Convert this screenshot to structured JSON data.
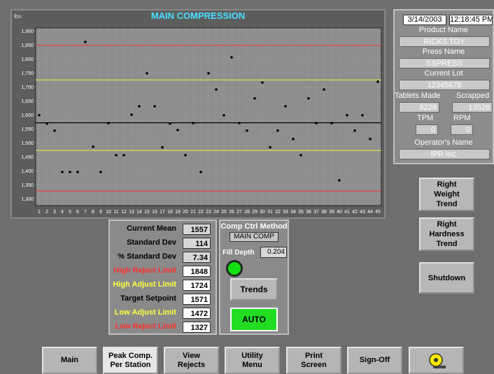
{
  "chart": {
    "title": "MAIN COMPRESSION",
    "unit": "lbs.",
    "y_ticks": [
      "1,900",
      "1,850",
      "1,800",
      "1,750",
      "1,700",
      "1,650",
      "1,600",
      "1,550",
      "1,500",
      "1,450",
      "1,400",
      "1,350",
      "1,300"
    ],
    "x_ticks": [
      "1",
      "2",
      "3",
      "4",
      "5",
      "6",
      "7",
      "8",
      "9",
      "10",
      "11",
      "12",
      "13",
      "14",
      "15",
      "16",
      "17",
      "18",
      "19",
      "20",
      "21",
      "22",
      "23",
      "24",
      "25",
      "26",
      "27",
      "28",
      "29",
      "30",
      "31",
      "32",
      "33",
      "34",
      "35",
      "36",
      "37",
      "38",
      "39",
      "40",
      "41",
      "42",
      "43",
      "44",
      "45"
    ]
  },
  "chart_data": {
    "type": "scatter",
    "title": "MAIN COMPRESSION",
    "ylabel": "lbs.",
    "ylim": [
      1275,
      1910
    ],
    "x": [
      1,
      2,
      3,
      4,
      5,
      6,
      7,
      8,
      9,
      10,
      11,
      12,
      13,
      14,
      15,
      16,
      17,
      18,
      19,
      20,
      21,
      22,
      23,
      24,
      25,
      26,
      27,
      28,
      29,
      30,
      31,
      32,
      33,
      34,
      35,
      36,
      37,
      38,
      39,
      40,
      41,
      42,
      43,
      44,
      45
    ],
    "values": [
      1598,
      1568,
      1543,
      1395,
      1395,
      1395,
      1860,
      1485,
      1395,
      1570,
      1455,
      1455,
      1600,
      1630,
      1748,
      1630,
      1483,
      1568,
      1545,
      1455,
      1570,
      1395,
      1748,
      1690,
      1598,
      1805,
      1570,
      1543,
      1658,
      1715,
      1483,
      1543,
      1630,
      1513,
      1455,
      1658,
      1570,
      1690,
      1570,
      1365,
      1598,
      1543,
      1598,
      1513,
      1718
    ],
    "reference_lines": [
      {
        "name": "High Reject Limit",
        "value": 1848,
        "color": "#e03b3b"
      },
      {
        "name": "High Adjust Limit",
        "value": 1724,
        "color": "#e0e04a"
      },
      {
        "name": "Target Setpoint",
        "value": 1571,
        "color": "#000000"
      },
      {
        "name": "Low Adjust Limit",
        "value": 1472,
        "color": "#e0e04a"
      },
      {
        "name": "Low Reject Limit",
        "value": 1327,
        "color": "#e03b3b"
      }
    ]
  },
  "stats": [
    {
      "label": "Current Mean",
      "value": "1557",
      "color": "#000000",
      "box": "readonly"
    },
    {
      "label": "Standard Dev",
      "value": "114",
      "color": "#000000",
      "box": "readonly"
    },
    {
      "label": "% Standard Dev",
      "value": "7.34",
      "color": "#000000",
      "box": "readonly"
    },
    {
      "label": "High Reject Limit",
      "value": "1848",
      "color": "#ff3030",
      "box": "white"
    },
    {
      "label": "High Adjust Limit",
      "value": "1724",
      "color": "#ffff40",
      "box": "white"
    },
    {
      "label": "Target Setpoint",
      "value": "1571",
      "color": "#000000",
      "box": "white"
    },
    {
      "label": "Low Adjust Limit",
      "value": "1472",
      "color": "#ffff40",
      "box": "white"
    },
    {
      "label": "Low Reject Limit",
      "value": "1327",
      "color": "#ff3030",
      "box": "white"
    }
  ],
  "comp": {
    "title": "Comp Ctrl Method",
    "method": "MAIN COMP",
    "fill_label": "Fill Depth",
    "fill_value": "0.204",
    "trends": "Trends",
    "auto": "AUTO"
  },
  "info": {
    "date": "3/14/2003",
    "time": "12:18:45 PM",
    "product_label": "Product Name",
    "product": "RICKS TOY",
    "press_label": "Press Name",
    "press": "SSPRESS",
    "lot_label": "Current Lot",
    "lot": "12345678",
    "tablets_label": "Tablets Made",
    "tablets": "8228",
    "scrapped_label": "Scrapped",
    "scrapped": "13528",
    "tpm_label": "TPM",
    "tpm": "0",
    "rpm_label": "RPM",
    "rpm": "0",
    "operator_label": "Operator's Name",
    "operator": "IPR Inc."
  },
  "side_buttons": {
    "weight": "Right\nWeight\nTrend",
    "hardness": "Right\nHardness\nTrend",
    "shutdown": "Shutdown"
  },
  "nav": [
    {
      "label": "Main"
    },
    {
      "label": "Peak Comp.\nPer Station"
    },
    {
      "label": "View\nRejects"
    },
    {
      "label": "Utility\nMenu"
    },
    {
      "label": "Print\nScreen"
    },
    {
      "label": "Sign-Off"
    }
  ],
  "colors": {
    "active_nav": "#e6e6e6",
    "auto_green": "#22dd22",
    "chart_bg": "#5d5d5d",
    "plot_bg": "#8e8e8e"
  }
}
